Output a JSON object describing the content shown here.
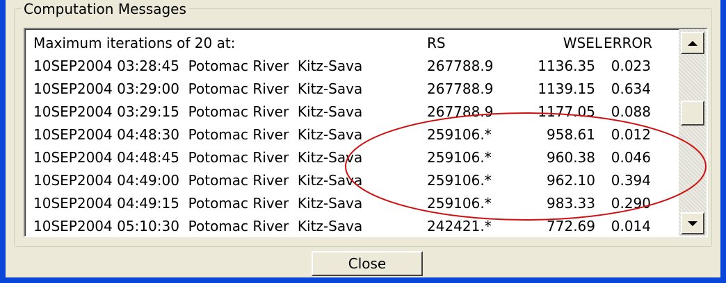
{
  "group": {
    "title": "Computation Messages"
  },
  "list": {
    "header": {
      "desc": "Maximum iterations of 20 at:",
      "rs": "RS",
      "wsel": "WSEL",
      "error": "ERROR"
    },
    "rows": [
      {
        "desc": "10SEP2004 03:28:45  Potomac River  Kitz-Sava",
        "rs": "267788.9",
        "wsel": "1136.35",
        "error": "0.023"
      },
      {
        "desc": "10SEP2004 03:29:00  Potomac River  Kitz-Sava",
        "rs": "267788.9",
        "wsel": "1139.15",
        "error": "0.634"
      },
      {
        "desc": "10SEP2004 03:29:15  Potomac River  Kitz-Sava",
        "rs": "267788.9",
        "wsel": "1177.05",
        "error": "0.088"
      },
      {
        "desc": "10SEP2004 04:48:30  Potomac River  Kitz-Sava",
        "rs": "259106.*",
        "wsel": "958.61",
        "error": "0.012"
      },
      {
        "desc": "10SEP2004 04:48:45  Potomac River  Kitz-Sava",
        "rs": "259106.*",
        "wsel": "960.38",
        "error": "0.046"
      },
      {
        "desc": "10SEP2004 04:49:00  Potomac River  Kitz-Sava",
        "rs": "259106.*",
        "wsel": "962.10",
        "error": "0.394"
      },
      {
        "desc": "10SEP2004 04:49:15  Potomac River  Kitz-Sava",
        "rs": "259106.*",
        "wsel": "983.33",
        "error": "0.290"
      },
      {
        "desc": "10SEP2004 05:10:30  Potomac River  Kitz-Sava",
        "rs": "242421.*",
        "wsel": "772.69",
        "error": "0.014"
      }
    ]
  },
  "scroll": {
    "position": 0.35
  },
  "footer": {
    "close_label": "Close"
  },
  "colors": {
    "window_border": "#0a46d8",
    "dialog_bg": "#ece9d8",
    "annotation": "#d01010"
  }
}
